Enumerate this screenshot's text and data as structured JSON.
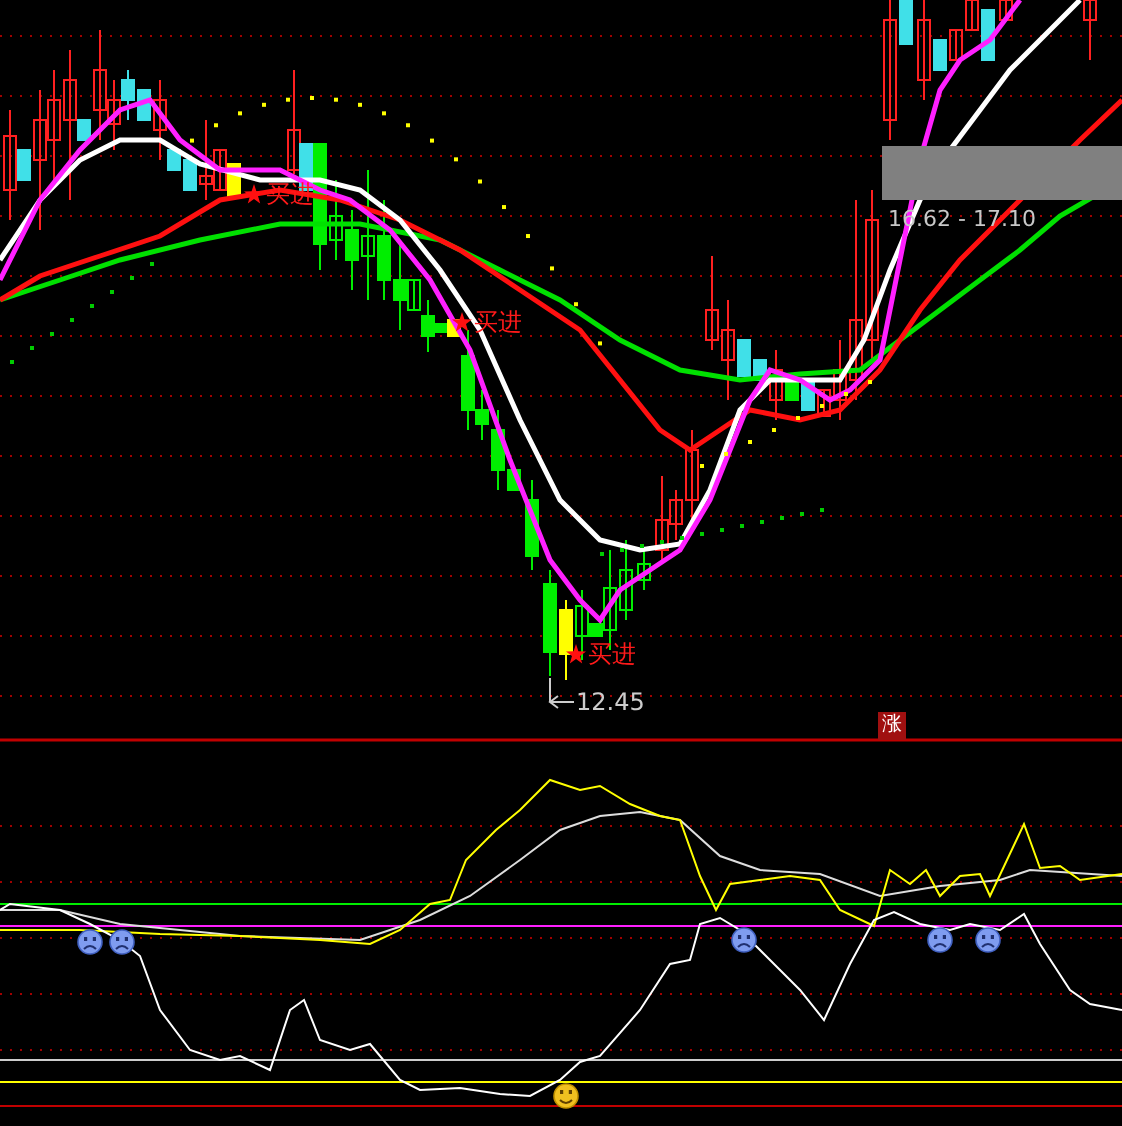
{
  "chart": {
    "signals": [
      {
        "label": "买进"
      },
      {
        "label": "买进"
      },
      {
        "label": "买进"
      }
    ],
    "low_marker": "12.45",
    "range_label": "16.62 - 17.10",
    "badge": "涨"
  }
}
